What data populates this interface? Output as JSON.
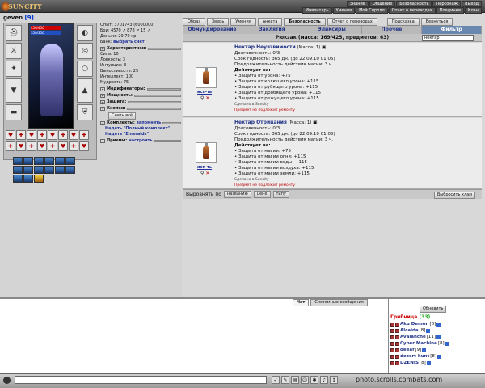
{
  "header": {
    "logo": "SUNCITY",
    "menu_top": [
      "Знание",
      "Общение",
      "Безопасность",
      "Персонаж",
      "Выход"
    ],
    "menu_bottom": [
      "Инвентарь",
      "Умения",
      "Мой Сиролл",
      "Отчет о переводах",
      "Поединки",
      "Клан"
    ]
  },
  "character": {
    "name": "geven",
    "level": "[9]",
    "hp_text": "450/450",
    "mp_text": "350/350",
    "exp": "Опыт: 3701743 (6000000)",
    "stats_line": "Бои: 4570 ↗ 878 ↗ 15 ↗",
    "money": "Деньги: 29.79 кр.",
    "bank": "Банк:",
    "bank_link": "выбрать счёт",
    "characteristics_header": "Характеристики:",
    "attributes": [
      "Сила: 10",
      "Ловкость: 3",
      "Интуиция: 3",
      "Выносливость: 25",
      "Интеллект: 100",
      "Мудрость: 75"
    ],
    "modifiers": "Модификаторы:",
    "power": "Мощность:",
    "protection": "Защита:",
    "buttons_header": "Кнопки:",
    "remove_all": "Снять всё",
    "sets_header": "Комплекты:",
    "remember": "запомнить",
    "set1": "Надеть \"Полный комплект\"",
    "set2": "Надеть \"Emeralds\"",
    "receptions": "Приемы:",
    "configure": "настроить"
  },
  "tabs": [
    "Образ",
    "Зверь",
    "Умения",
    "Анкета",
    "Безопасность",
    "Отчет о переводах",
    "Подсказка",
    "Вернуться"
  ],
  "subtabs": [
    "Обмундирование",
    "Заклятия",
    "Эликсиры",
    "Прочее",
    "Фильтр"
  ],
  "backpack": "Рюкзак (масса: 169/425, предметов: 63)",
  "filter_value": "нектар",
  "items": [
    {
      "name": "Нектар Неуязвимости",
      "mass": "(Масса: 1)",
      "durability": "Долговечность: 0/3",
      "expiry": "Срок годности: 365 дн. (до 22.09.10 01:05)",
      "duration": "Продолжительность действия магии: 3 ч.",
      "acts": "Действует на:",
      "effects": [
        "• Защита от урона: +75",
        "• Защита от колющего урона: +115",
        "• Защита от рубящего урона: +115",
        "• Защита от дробящего урона: +115",
        "• Защита от режущего урона: +115"
      ],
      "made": "Сделано в Suncity",
      "norepair": "Предмет не подлежит ремонту",
      "use": "исп-ть"
    },
    {
      "name": "Нектар Отрицания",
      "mass": "(Масса: 1)",
      "durability": "Долговечность: 0/3",
      "expiry": "Срок годности: 365 дн. (до 22.09.10 01:05)",
      "duration": "Продолжительность действия магии: 3 ч.",
      "acts": "Действует на:",
      "effects": [
        "• Защита от магии: +75",
        "• Защита от магии огня: +115",
        "• Защита от магии воды: +115",
        "• Защита от магии воздуха: +115",
        "• Защита от магии земли: +115"
      ],
      "made": "Сделано в Suncity",
      "norepair": "Предмет не подлежит ремонту",
      "use": "исп-ть"
    }
  ],
  "sortbar": {
    "label": "Выровнять по",
    "by_name": "названию",
    "by_price": "цене",
    "by_type": "типу",
    "throw_junk": "Выбросить хлам"
  },
  "chat": {
    "tab_chat": "Чат",
    "tab_system": "Системные сообщения"
  },
  "online": {
    "refresh": "Обновить",
    "location": "Грибница",
    "count": "(33)",
    "players": [
      {
        "name": "Aku Demon",
        "level": "[8]"
      },
      {
        "name": "Alcaida",
        "level": "[8]"
      },
      {
        "name": "Avalanche",
        "level": "[11]"
      },
      {
        "name": "Cyber Machine",
        "level": "[8]"
      },
      {
        "name": "deeaf",
        "level": "[9]"
      },
      {
        "name": "dezert hunt",
        "level": "[8]"
      },
      {
        "name": "DZENIS",
        "level": "[8]"
      }
    ]
  },
  "watermark": "photo.scrolls.combats.com"
}
